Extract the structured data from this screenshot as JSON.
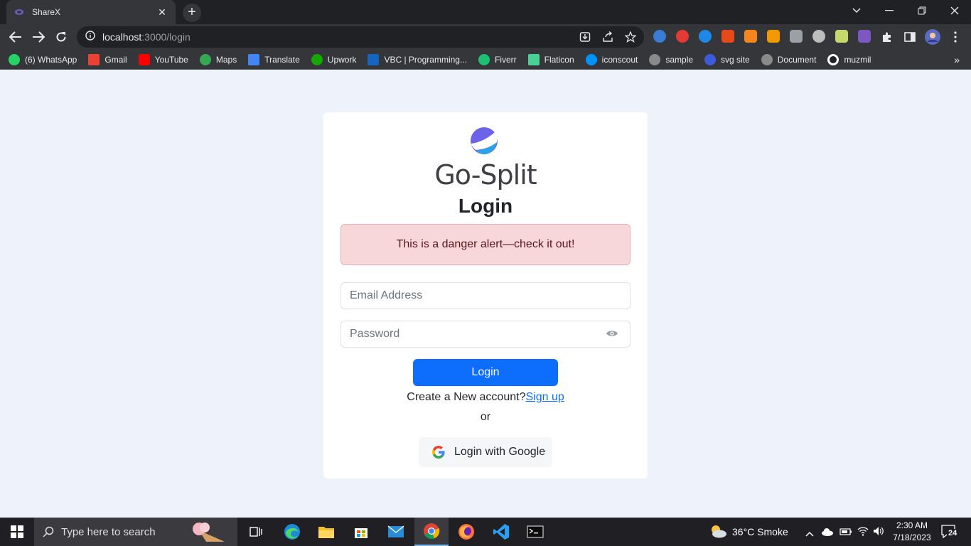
{
  "browser": {
    "tab_title": "ShareX",
    "tab_close": "✕",
    "new_tab": "+",
    "url_host": "localhost",
    "url_path": ":3000/login",
    "bookmarks": [
      {
        "label": "(6) WhatsApp",
        "icon": "whatsapp-icon",
        "color": "#25d366"
      },
      {
        "label": "Gmail",
        "icon": "gmail-icon",
        "color": "#ea4335"
      },
      {
        "label": "YouTube",
        "icon": "youtube-icon",
        "color": "#ff0000"
      },
      {
        "label": "Maps",
        "icon": "maps-icon",
        "color": "#34a853"
      },
      {
        "label": "Translate",
        "icon": "translate-icon",
        "color": "#4285f4"
      },
      {
        "label": "Upwork",
        "icon": "upwork-icon",
        "color": "#14a800"
      },
      {
        "label": "VBC | Programming...",
        "icon": "vbc-icon",
        "color": "#1565c0"
      },
      {
        "label": "Fiverr",
        "icon": "fiverr-icon",
        "color": "#1dbf73"
      },
      {
        "label": "Flaticon",
        "icon": "flaticon-icon",
        "color": "#4ad295"
      },
      {
        "label": "iconscout",
        "icon": "iconscout-icon",
        "color": "#0093ff"
      },
      {
        "label": "sample",
        "icon": "globe-icon",
        "color": "#8a8a8a"
      },
      {
        "label": "svg site",
        "icon": "svg-site-icon",
        "color": "#3b5bdb"
      },
      {
        "label": "Document",
        "icon": "globe-icon",
        "color": "#8a8a8a"
      },
      {
        "label": "muzmil",
        "icon": "github-icon",
        "color": "#ffffff"
      }
    ],
    "more": "»"
  },
  "page": {
    "brand": "Go-Split",
    "heading": "Login",
    "alert": "This is a danger alert—check it out!",
    "email_placeholder": "Email Address",
    "password_placeholder": "Password",
    "login_button": "Login",
    "signup_prompt": "Create a New account?",
    "signup_link": "Sign up",
    "or": "or",
    "google_button": "Login with Google",
    "colors": {
      "primary": "#0d6efd",
      "danger_bg": "#f8d7da",
      "danger_text": "#58151c"
    }
  },
  "taskbar": {
    "search_placeholder": "Type here to search",
    "weather": "36°C  Smoke",
    "time": "2:30 AM",
    "date": "7/18/2023",
    "notifications": "24"
  }
}
